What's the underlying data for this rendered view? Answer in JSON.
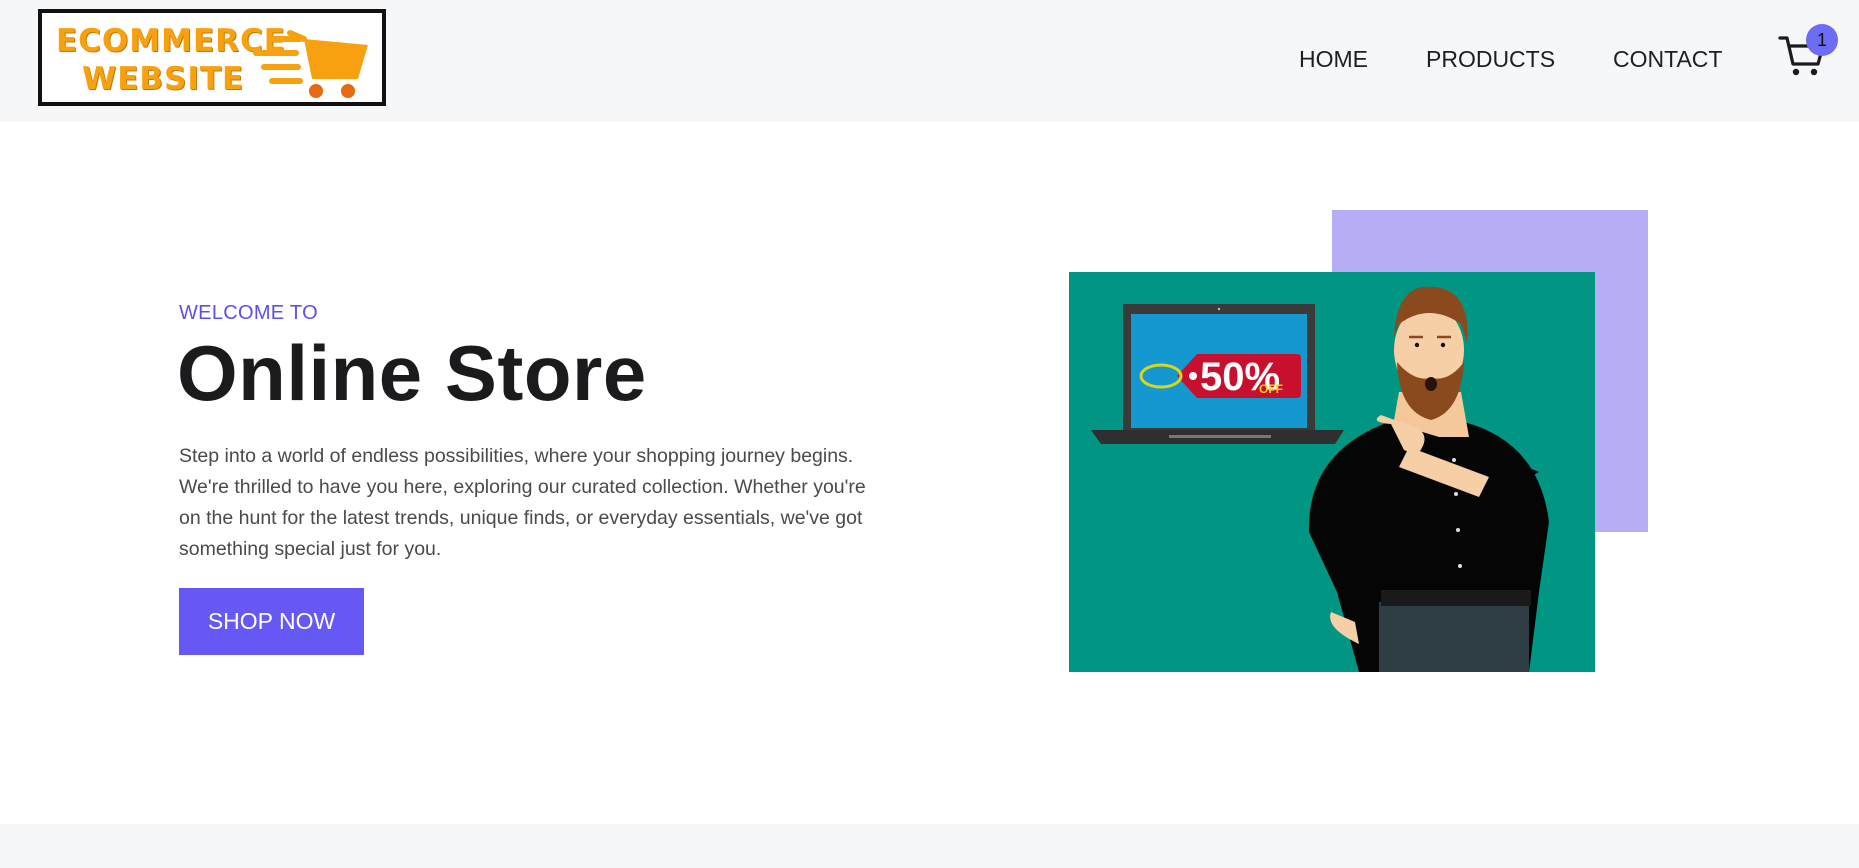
{
  "header": {
    "logo": {
      "line1": "ECOMMERCE",
      "line2": "WEBSITE"
    },
    "nav": [
      {
        "label": "HOME"
      },
      {
        "label": "PRODUCTS"
      },
      {
        "label": "CONTACT"
      }
    ],
    "cart": {
      "count": "1",
      "icon": "cart-icon"
    }
  },
  "hero": {
    "eyebrow": "WELCOME TO",
    "title": "Online Store",
    "description": "Step into a world of endless possibilities, where your shopping journey begins. We're thrilled to have you here, exploring our curated collection. Whether you're on the hunt for the latest trends, unique finds, or everyday essentials, we've got something special just for you.",
    "cta_label": "SHOP NOW",
    "illustration": {
      "sale_tag_value": "50%",
      "sale_tag_suffix": "OFF"
    }
  },
  "colors": {
    "accent": "#6558f5",
    "accent_text": "#5b4ff0",
    "header_bg": "#f6f7f9",
    "illustration_bg": "#009683",
    "purple_block": "#b6adf7",
    "logo_orange": "#f7a111"
  }
}
